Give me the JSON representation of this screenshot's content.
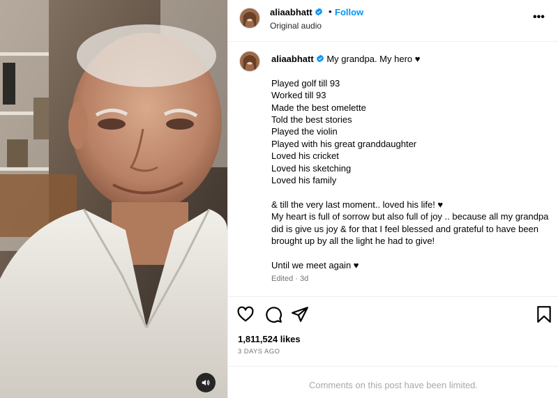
{
  "media": {
    "audio_icon": "speaker-icon"
  },
  "header": {
    "username": "aliaabhatt",
    "separator": "•",
    "follow_label": "Follow",
    "subtitle": "Original audio",
    "more_icon": "•••"
  },
  "caption": {
    "username": "aliaabhatt",
    "title": "My grandpa. My hero ♥",
    "lines": [
      "Played golf till 93",
      "Worked till 93",
      "Made the best omelette",
      "Told the best stories",
      "Played the violin",
      "Played with his great granddaughter",
      "Loved his cricket",
      "Loved his sketching",
      "Loved his family"
    ],
    "para1": "& till the very last moment.. loved his life! ♥",
    "para2": "My heart is full of sorrow but also full of joy .. because all my grandpa did is give us joy & for that I feel blessed and grateful to have been brought up by all the light he had to give!",
    "para3": "Until we meet again ♥",
    "edited": "Edited · 3d"
  },
  "actions": {
    "like_icon": "heart-icon",
    "comment_icon": "comment-icon",
    "share_icon": "share-icon",
    "save_icon": "bookmark-icon",
    "likes": "1,811,524 likes",
    "time": "3 DAYS AGO"
  },
  "comments": {
    "limited_text": "Comments on this post have been limited."
  },
  "colors": {
    "accent": "#0095f6",
    "verified": "#0095f6",
    "muted": "#737373",
    "border": "#efefef"
  }
}
